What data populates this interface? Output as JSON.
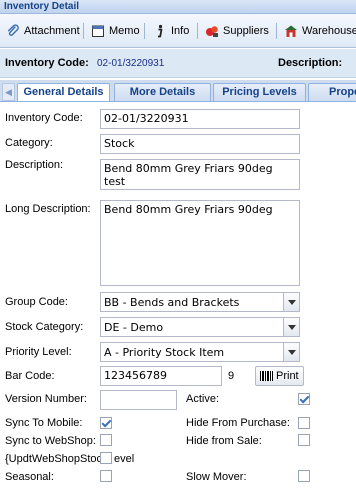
{
  "window": {
    "title": "Inventory Detail"
  },
  "toolbar": {
    "attachment": "Attachment",
    "memo": "Memo",
    "info": "Info",
    "suppliers": "Suppliers",
    "warehouses": "Warehouses"
  },
  "header": {
    "code_label": "Inventory Code:",
    "code_value": "02-01/3220931",
    "desc_label": "Description:"
  },
  "tabs": [
    "General Details",
    "More Details",
    "Pricing Levels",
    "Prope"
  ],
  "tab_scroll_icon": "arrow-left",
  "form": {
    "inventory_code_label": "Inventory Code:",
    "inventory_code_value": "02-01/3220931",
    "category_label": "Category:",
    "category_value": "Stock",
    "description_label": "Description:",
    "description_value": "Bend 80mm Grey Friars 90deg test",
    "long_description_label": "Long Description:",
    "long_description_value": "Bend 80mm Grey Friars 90deg",
    "group_code_label": "Group Code:",
    "group_code_value": "BB - Bends and Brackets",
    "stock_category_label": "Stock Category:",
    "stock_category_value": "DE - Demo",
    "priority_level_label": "Priority Level:",
    "priority_level_value": "A - Priority Stock Item",
    "bar_code_label": "Bar Code:",
    "bar_code_value": "123456789",
    "bar_code_digit": "9",
    "print_label": "Print",
    "version_number_label": "Version Number:",
    "version_number_value": "",
    "active_label": "Active:",
    "active": true,
    "sync_mobile_label": "Sync To Mobile:",
    "sync_mobile": true,
    "hide_purchase_label": "Hide From Purchase:",
    "hide_purchase": false,
    "sync_webshop_label": "Sync to WebShop:",
    "sync_webshop": false,
    "hide_sale_label": "Hide from Sale:",
    "hide_sale": false,
    "updt_webshop_label": "{UpdtWebShopStoc",
    "updt_webshop_label_tail": "evel",
    "updt_webshop": false,
    "seasonal_label": "Seasonal:",
    "seasonal": false,
    "slow_mover_label": "Slow Mover:",
    "slow_mover": false
  },
  "colors": {
    "accent": "#15428b",
    "header_bg": "#dde8f5",
    "tab_border": "#8db2e3"
  }
}
